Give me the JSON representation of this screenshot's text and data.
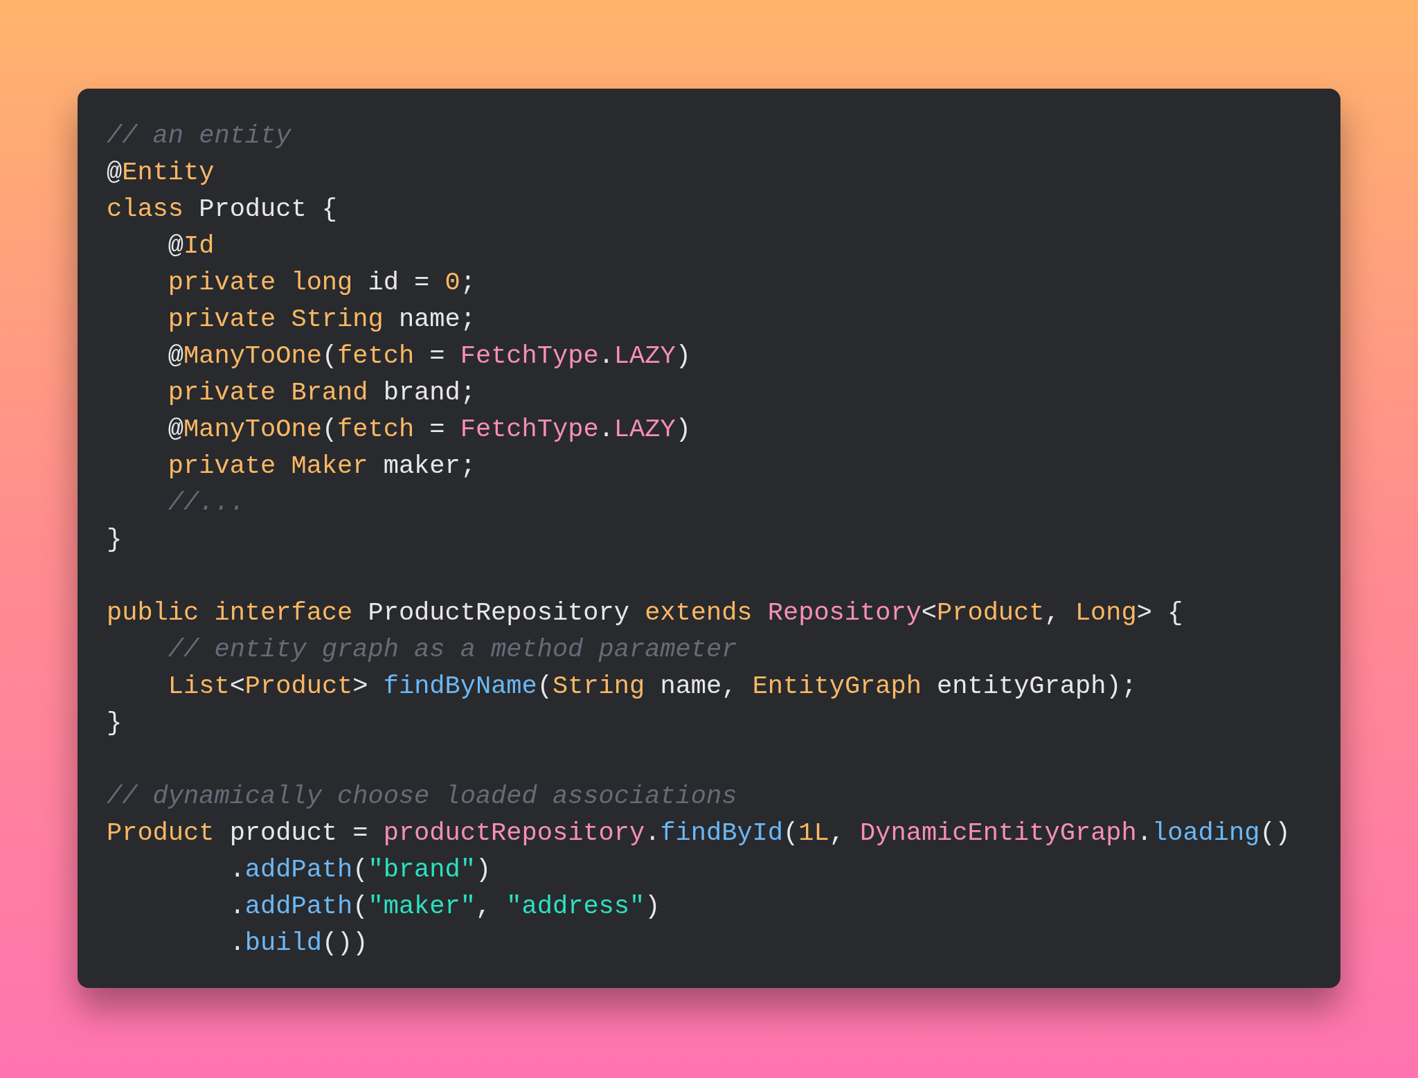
{
  "code_blocks": [
    {
      "lines": [
        [
          {
            "kind": "comment",
            "text": "// an entity"
          }
        ],
        [
          {
            "kind": "plain",
            "text": "@"
          },
          {
            "kind": "keyword",
            "text": "Entity"
          }
        ],
        [
          {
            "kind": "keyword",
            "text": "class"
          },
          {
            "kind": "plain",
            "text": " Product {"
          }
        ],
        [
          {
            "kind": "plain",
            "text": "    @"
          },
          {
            "kind": "keyword",
            "text": "Id"
          }
        ],
        [
          {
            "kind": "keyword",
            "text": "    private long"
          },
          {
            "kind": "plain",
            "text": " id = "
          },
          {
            "kind": "keyword",
            "text": "0"
          },
          {
            "kind": "plain",
            "text": ";"
          }
        ],
        [
          {
            "kind": "keyword",
            "text": "    private String"
          },
          {
            "kind": "plain",
            "text": " name;"
          }
        ],
        [
          {
            "kind": "plain",
            "text": "    @"
          },
          {
            "kind": "keyword",
            "text": "ManyToOne"
          },
          {
            "kind": "plain",
            "text": "("
          },
          {
            "kind": "keyword",
            "text": "fetch"
          },
          {
            "kind": "plain",
            "text": " = "
          },
          {
            "kind": "type",
            "text": "FetchType"
          },
          {
            "kind": "plain",
            "text": "."
          },
          {
            "kind": "type",
            "text": "LAZY"
          },
          {
            "kind": "plain",
            "text": ")"
          }
        ],
        [
          {
            "kind": "keyword",
            "text": "    private Brand"
          },
          {
            "kind": "plain",
            "text": " brand;"
          }
        ],
        [
          {
            "kind": "plain",
            "text": "    @"
          },
          {
            "kind": "keyword",
            "text": "ManyToOne"
          },
          {
            "kind": "plain",
            "text": "("
          },
          {
            "kind": "keyword",
            "text": "fetch"
          },
          {
            "kind": "plain",
            "text": " = "
          },
          {
            "kind": "type",
            "text": "FetchType"
          },
          {
            "kind": "plain",
            "text": "."
          },
          {
            "kind": "type",
            "text": "LAZY"
          },
          {
            "kind": "plain",
            "text": ")"
          }
        ],
        [
          {
            "kind": "keyword",
            "text": "    private Maker"
          },
          {
            "kind": "plain",
            "text": " maker;"
          }
        ],
        [
          {
            "kind": "comment",
            "text": "    //..."
          }
        ],
        [
          {
            "kind": "plain",
            "text": "}"
          }
        ]
      ]
    },
    {
      "lines": [
        [
          {
            "kind": "keyword",
            "text": "public interface"
          },
          {
            "kind": "plain",
            "text": " ProductRepository "
          },
          {
            "kind": "keyword",
            "text": "extends "
          },
          {
            "kind": "type",
            "text": "Repository"
          },
          {
            "kind": "plain",
            "text": "<"
          },
          {
            "kind": "keyword",
            "text": "Product"
          },
          {
            "kind": "plain",
            "text": ", "
          },
          {
            "kind": "keyword",
            "text": "Long"
          },
          {
            "kind": "plain",
            "text": "> {"
          }
        ],
        [
          {
            "kind": "comment",
            "text": "    // entity graph as a method parameter"
          }
        ],
        [
          {
            "kind": "keyword",
            "text": "    List"
          },
          {
            "kind": "plain",
            "text": "<"
          },
          {
            "kind": "keyword",
            "text": "Product"
          },
          {
            "kind": "plain",
            "text": "> "
          },
          {
            "kind": "function",
            "text": "findByName"
          },
          {
            "kind": "plain",
            "text": "("
          },
          {
            "kind": "keyword",
            "text": "String"
          },
          {
            "kind": "plain",
            "text": " name, "
          },
          {
            "kind": "keyword",
            "text": "EntityGraph"
          },
          {
            "kind": "plain",
            "text": " entityGraph);"
          }
        ],
        [
          {
            "kind": "plain",
            "text": "}"
          }
        ]
      ]
    },
    {
      "lines": [
        [
          {
            "kind": "comment",
            "text": "// dynamically choose loaded associations"
          }
        ],
        [
          {
            "kind": "keyword",
            "text": "Product"
          },
          {
            "kind": "plain",
            "text": " product = "
          },
          {
            "kind": "type",
            "text": "productRepository"
          },
          {
            "kind": "plain",
            "text": "."
          },
          {
            "kind": "function",
            "text": "findById"
          },
          {
            "kind": "plain",
            "text": "("
          },
          {
            "kind": "keyword",
            "text": "1L"
          },
          {
            "kind": "plain",
            "text": ", "
          },
          {
            "kind": "type",
            "text": "DynamicEntityGraph"
          },
          {
            "kind": "plain",
            "text": "."
          },
          {
            "kind": "function",
            "text": "loading"
          },
          {
            "kind": "plain",
            "text": "()"
          }
        ],
        [
          {
            "kind": "plain",
            "text": "        ."
          },
          {
            "kind": "function",
            "text": "addPath"
          },
          {
            "kind": "plain",
            "text": "("
          },
          {
            "kind": "string",
            "text": "\"brand\""
          },
          {
            "kind": "plain",
            "text": ")"
          }
        ],
        [
          {
            "kind": "plain",
            "text": "        ."
          },
          {
            "kind": "function",
            "text": "addPath"
          },
          {
            "kind": "plain",
            "text": "("
          },
          {
            "kind": "string",
            "text": "\"maker\""
          },
          {
            "kind": "plain",
            "text": ", "
          },
          {
            "kind": "string",
            "text": "\"address\""
          },
          {
            "kind": "plain",
            "text": ")"
          }
        ],
        [
          {
            "kind": "plain",
            "text": "        ."
          },
          {
            "kind": "function",
            "text": "build"
          },
          {
            "kind": "plain",
            "text": "())"
          }
        ]
      ]
    }
  ]
}
